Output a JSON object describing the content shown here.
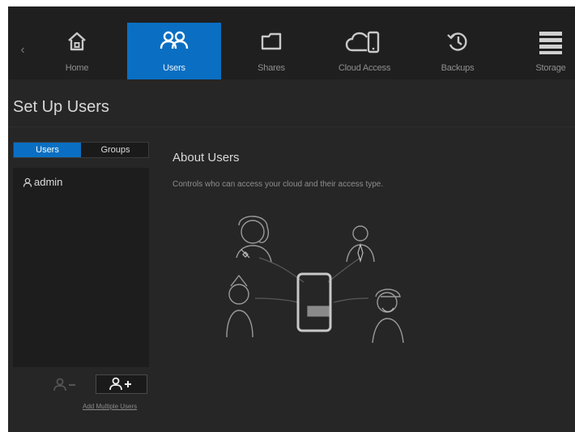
{
  "nav": {
    "items": [
      {
        "label": "Home",
        "icon": "home-icon"
      },
      {
        "label": "Users",
        "icon": "users-icon"
      },
      {
        "label": "Shares",
        "icon": "folder-icon"
      },
      {
        "label": "Cloud Access",
        "icon": "cloud-device-icon"
      },
      {
        "label": "Backups",
        "icon": "history-icon"
      },
      {
        "label": "Storage",
        "icon": "storage-icon"
      }
    ],
    "active": "Users",
    "prev_icon": "chevron-left-icon"
  },
  "page": {
    "title": "Set Up Users"
  },
  "segmented": {
    "users_label": "Users",
    "groups_label": "Groups",
    "selected": "Users"
  },
  "user_list": {
    "items": [
      {
        "name": "admin",
        "icon": "user-icon"
      }
    ]
  },
  "actions": {
    "remove_icon": "remove-user-icon",
    "add_icon": "add-user-icon",
    "add_multiple_label": "Add Multiple Users"
  },
  "about": {
    "heading": "About Users",
    "description": "Controls who can access your cloud and their access type."
  },
  "colors": {
    "accent": "#0a6fc2",
    "background": "#262626",
    "nav_background": "#1f1f1f",
    "panel_background": "#1d1d1d"
  }
}
